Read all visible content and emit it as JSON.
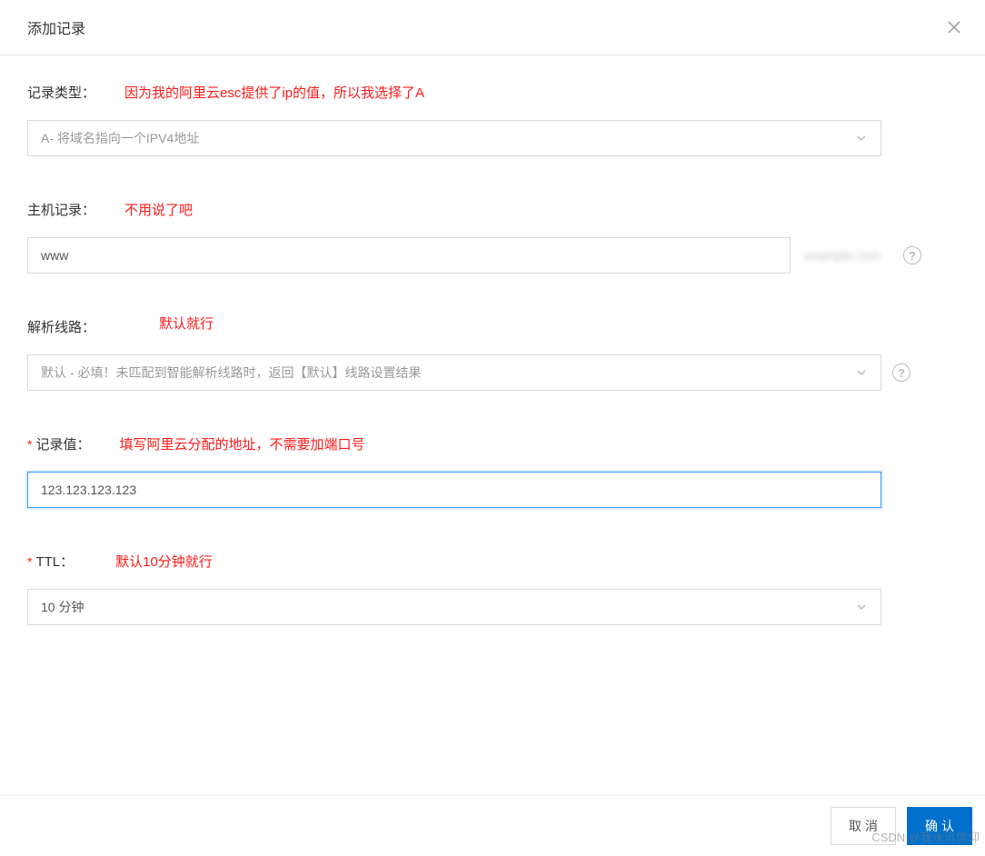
{
  "header": {
    "title": "添加记录"
  },
  "fields": {
    "recordType": {
      "label": "记录类型：",
      "annotation": "因为我的阿里云esc提供了ip的值，所以我选择了A",
      "value": "A- 将域名指向一个IPV4地址"
    },
    "hostRecord": {
      "label": "主机记录：",
      "annotation": "不用说了吧",
      "value": "www",
      "suffix": ".example.com"
    },
    "line": {
      "label": "解析线路：",
      "annotation": "默认就行",
      "value": "默认 - 必填！未匹配到智能解析线路时，返回【默认】线路设置结果"
    },
    "recordValue": {
      "label": "记录值：",
      "required": "*",
      "annotation": "填写阿里云分配的地址，不需要加端口号",
      "value": "123.123.123.123"
    },
    "ttl": {
      "label": "TTL：",
      "required": "*",
      "annotation": "默认10分钟就行",
      "value": "10 分钟"
    }
  },
  "help": "?",
  "footer": {
    "cancel": "取消",
    "confirm": "确认"
  },
  "watermark": "CSDN @我永远信仰"
}
